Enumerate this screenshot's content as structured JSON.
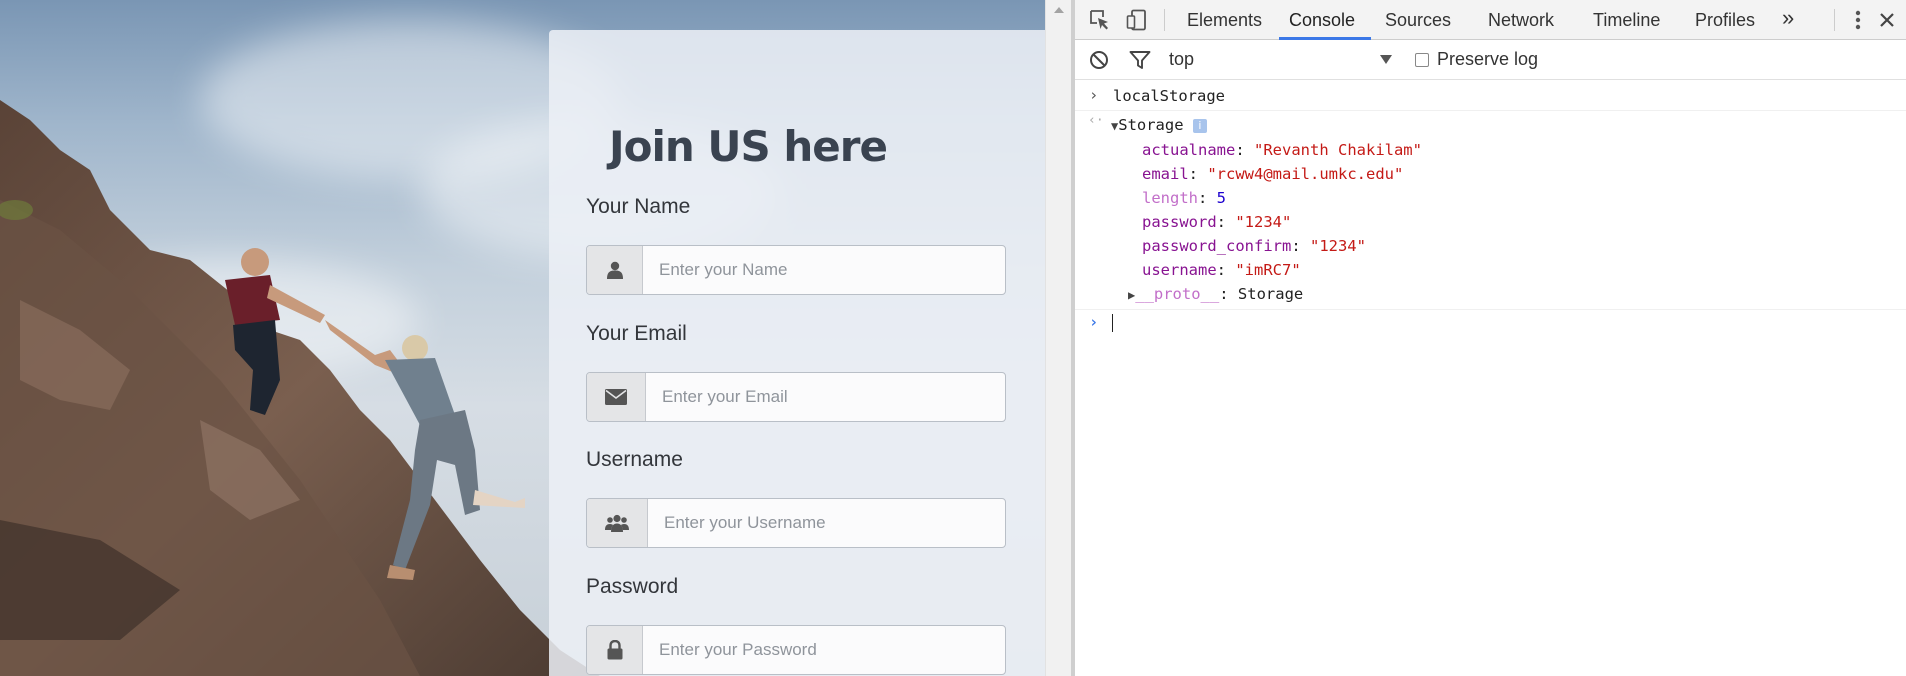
{
  "page": {
    "title": "Join US here",
    "fields": [
      {
        "label": "Your Name",
        "placeholder": "Enter your Name",
        "icon": "user-icon"
      },
      {
        "label": "Your Email",
        "placeholder": "Enter your Email",
        "icon": "envelope-icon"
      },
      {
        "label": "Username",
        "placeholder": "Enter your Username",
        "icon": "users-icon"
      },
      {
        "label": "Password",
        "placeholder": "Enter your Password",
        "icon": "lock-icon"
      }
    ]
  },
  "devtools": {
    "tabs": [
      "Elements",
      "Console",
      "Sources",
      "Network",
      "Timeline",
      "Profiles"
    ],
    "active_tab": "Console",
    "more_tabs_glyph": "»",
    "context": "top",
    "preserve_log_label": "Preserve log",
    "console": {
      "command": "localStorage",
      "result_label": "Storage",
      "info_badge": "i",
      "entries": [
        {
          "key": "actualname",
          "value": "\"Revanth Chakilam\"",
          "type": "string"
        },
        {
          "key": "email",
          "value": "\"rcww4@mail.umkc.edu\"",
          "type": "string"
        },
        {
          "key": "length",
          "value": "5",
          "type": "number"
        },
        {
          "key": "password",
          "value": "\"1234\"",
          "type": "string"
        },
        {
          "key": "password_confirm",
          "value": "\"1234\"",
          "type": "string"
        },
        {
          "key": "username",
          "value": "\"imRC7\"",
          "type": "string"
        }
      ],
      "proto_key": "__proto__",
      "proto_value": "Storage"
    },
    "colors": {
      "accent": "#3b78e7",
      "string": "#c41a16",
      "number": "#1c00cf",
      "key": "#881391"
    }
  }
}
